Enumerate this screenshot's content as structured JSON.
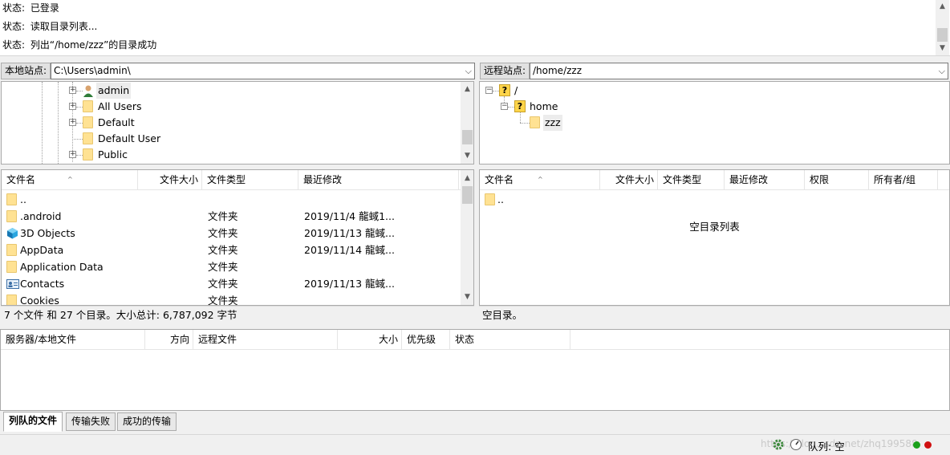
{
  "status_log": {
    "lines": [
      {
        "label": "状态:",
        "text": "已登录"
      },
      {
        "label": "状态:",
        "text": "读取目录列表..."
      },
      {
        "label": "状态:",
        "text": "列出“/home/zzz”的目录成功"
      }
    ]
  },
  "local": {
    "site_label": "本地站点:",
    "path": "C:\\Users\\admin\\",
    "tree": [
      "admin",
      "All Users",
      "Default",
      "Default User",
      "Public"
    ],
    "columns": [
      "文件名",
      "文件大小",
      "文件类型",
      "最近修改"
    ],
    "files": [
      {
        "name": "..",
        "size": "",
        "type": "",
        "modified": "",
        "icon": "folder-icon"
      },
      {
        "name": ".android",
        "size": "",
        "type": "文件夹",
        "modified": "2019/11/4 龍蜮1...",
        "icon": "folder-icon"
      },
      {
        "name": "3D Objects",
        "size": "",
        "type": "文件夹",
        "modified": "2019/11/13 龍蜮...",
        "icon": "3d-objects-icon"
      },
      {
        "name": "AppData",
        "size": "",
        "type": "文件夹",
        "modified": "2019/11/14 龍蜮...",
        "icon": "folder-icon"
      },
      {
        "name": "Application Data",
        "size": "",
        "type": "文件夹",
        "modified": "",
        "icon": "folder-icon"
      },
      {
        "name": "Contacts",
        "size": "",
        "type": "文件夹",
        "modified": "2019/11/13 龍蜮...",
        "icon": "contacts-icon"
      },
      {
        "name": "Cookies",
        "size": "",
        "type": "文件夹",
        "modified": "",
        "icon": "folder-icon"
      }
    ],
    "summary": "7 个文件 和 27 个目录。大小总计: 6,787,092 字节"
  },
  "remote": {
    "site_label": "远程站点:",
    "path": "/home/zzz",
    "tree": [
      "/",
      "home",
      "zzz"
    ],
    "columns": [
      "文件名",
      "文件大小",
      "文件类型",
      "最近修改",
      "权限",
      "所有者/组"
    ],
    "files": [
      {
        "name": "..",
        "icon": "folder-icon"
      }
    ],
    "empty_text": "空目录列表",
    "summary": "空目录。"
  },
  "queue": {
    "columns": [
      "服务器/本地文件",
      "方向",
      "远程文件",
      "大小",
      "优先级",
      "状态"
    ],
    "tabs": [
      "列队的文件",
      "传输失败",
      "成功的传输"
    ],
    "active_tab": 0
  },
  "bottom": {
    "queue_label": "队列: 空",
    "watermark": "https://blog.csdn.net/zhq199588"
  },
  "colors": {
    "led_green": "#1aa01a",
    "led_red": "#d01010"
  }
}
